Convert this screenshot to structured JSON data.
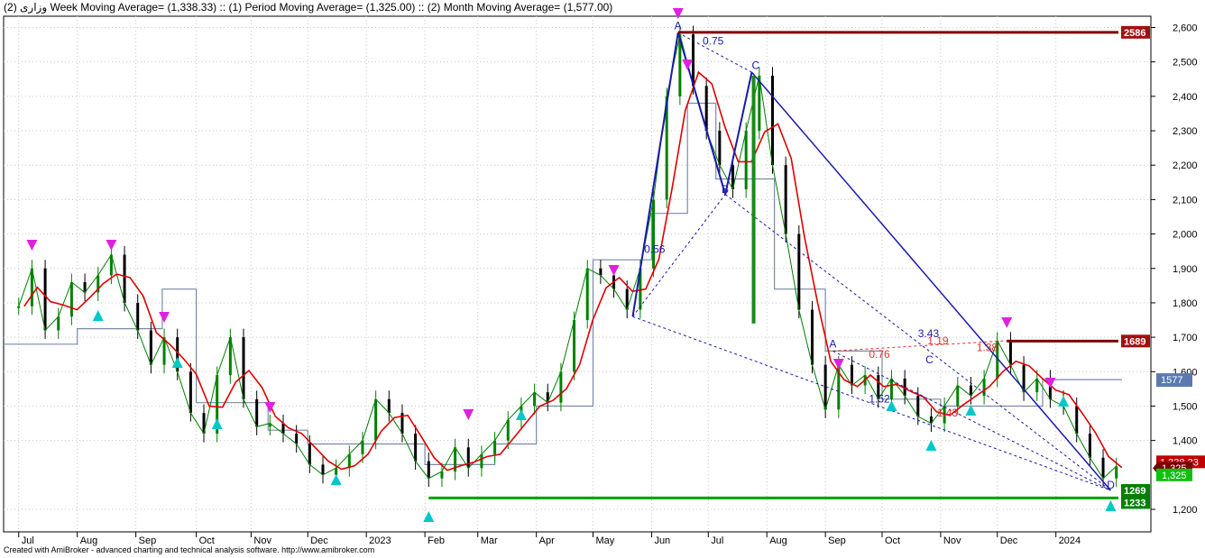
{
  "header": "وزارى (2) Week Moving Average= (1,338.33) :: (1) Period Moving Average= (1,325.00) :: (2) Month Moving Average= (1,577.00)",
  "footer": "Created with AmiBroker - advanced charting and technical analysis software. http://www.amibroker.com",
  "colors": {
    "price_up": "#008000",
    "price_down": "#000000",
    "fast_ma": "#e00000",
    "step_ma": "#7a8aa8",
    "pattern": "#1a1aaa",
    "sell_arrow": "#e020e0",
    "buy_arrow": "#00c8c8",
    "resistance": "#800000",
    "support": "#00a000",
    "ratio_red": "#e03030"
  },
  "chart_data": {
    "type": "line",
    "title": "",
    "ylim": [
      1160,
      2680
    ],
    "y_ticks": [
      "2,600",
      "2,500",
      "2,400",
      "2,300",
      "2,200",
      "2,100",
      "2,000",
      "1,900",
      "1,800",
      "1,700",
      "1,600",
      "1,500",
      "1,400",
      "1,200"
    ],
    "y_tick_values": [
      2600,
      2500,
      2400,
      2300,
      2200,
      2100,
      2000,
      1900,
      1800,
      1700,
      1600,
      1500,
      1400,
      1200
    ],
    "x_labels": [
      "Jul",
      "Aug",
      "Sep",
      "Oct",
      "Nov",
      "Dec",
      "2023",
      "Feb",
      "Mar",
      "Apr",
      "May",
      "Jun",
      "Jul",
      "Aug",
      "Sep",
      "Oct",
      "Nov",
      "Dec",
      "2024"
    ],
    "grid": true,
    "price_points": [
      [
        "2022-07-01",
        1790
      ],
      [
        "2022-07-08",
        1900
      ],
      [
        "2022-07-15",
        1720
      ],
      [
        "2022-07-22",
        1760
      ],
      [
        "2022-07-29",
        1860
      ],
      [
        "2022-08-05",
        1830
      ],
      [
        "2022-08-12",
        1880
      ],
      [
        "2022-08-19",
        1940
      ],
      [
        "2022-08-26",
        1800
      ],
      [
        "2022-09-02",
        1720
      ],
      [
        "2022-09-09",
        1620
      ],
      [
        "2022-09-16",
        1700
      ],
      [
        "2022-09-23",
        1600
      ],
      [
        "2022-09-30",
        1480
      ],
      [
        "2022-10-07",
        1420
      ],
      [
        "2022-10-14",
        1590
      ],
      [
        "2022-10-21",
        1700
      ],
      [
        "2022-10-28",
        1520
      ],
      [
        "2022-11-04",
        1440
      ],
      [
        "2022-11-11",
        1450
      ],
      [
        "2022-11-18",
        1420
      ],
      [
        "2022-11-25",
        1390
      ],
      [
        "2022-12-02",
        1330
      ],
      [
        "2022-12-09",
        1300
      ],
      [
        "2022-12-16",
        1320
      ],
      [
        "2022-12-23",
        1360
      ],
      [
        "2022-12-30",
        1400
      ],
      [
        "2023-01-06",
        1520
      ],
      [
        "2023-01-13",
        1480
      ],
      [
        "2023-01-20",
        1420
      ],
      [
        "2023-01-27",
        1340
      ],
      [
        "2023-02-03",
        1290
      ],
      [
        "2023-02-10",
        1310
      ],
      [
        "2023-02-17",
        1380
      ],
      [
        "2023-02-24",
        1320
      ],
      [
        "2023-03-03",
        1360
      ],
      [
        "2023-03-10",
        1400
      ],
      [
        "2023-03-17",
        1460
      ],
      [
        "2023-03-24",
        1500
      ],
      [
        "2023-03-31",
        1540
      ],
      [
        "2023-04-07",
        1510
      ],
      [
        "2023-04-14",
        1600
      ],
      [
        "2023-04-21",
        1750
      ],
      [
        "2023-04-28",
        1900
      ],
      [
        "2023-05-05",
        1880
      ],
      [
        "2023-05-12",
        1840
      ],
      [
        "2023-05-19",
        1780
      ],
      [
        "2023-05-26",
        1900
      ],
      [
        "2023-06-02",
        2100
      ],
      [
        "2023-06-09",
        2400
      ],
      [
        "2023-06-16",
        2580
      ],
      [
        "2023-06-23",
        2430
      ],
      [
        "2023-06-30",
        2300
      ],
      [
        "2023-07-07",
        2200
      ],
      [
        "2023-07-14",
        2130
      ],
      [
        "2023-07-21",
        2300
      ],
      [
        "2023-07-28",
        2460
      ],
      [
        "2023-08-04",
        2200
      ],
      [
        "2023-08-11",
        2000
      ],
      [
        "2023-08-18",
        1780
      ],
      [
        "2023-08-25",
        1620
      ],
      [
        "2023-09-01",
        1490
      ],
      [
        "2023-09-08",
        1620
      ],
      [
        "2023-09-15",
        1560
      ],
      [
        "2023-09-22",
        1590
      ],
      [
        "2023-09-29",
        1520
      ],
      [
        "2023-10-06",
        1580
      ],
      [
        "2023-10-13",
        1530
      ],
      [
        "2023-10-20",
        1470
      ],
      [
        "2023-10-27",
        1450
      ],
      [
        "2023-11-03",
        1500
      ],
      [
        "2023-11-10",
        1560
      ],
      [
        "2023-11-17",
        1530
      ],
      [
        "2023-11-24",
        1580
      ],
      [
        "2023-12-01",
        1690
      ],
      [
        "2023-12-08",
        1620
      ],
      [
        "2023-12-15",
        1540
      ],
      [
        "2023-12-22",
        1580
      ],
      [
        "2023-12-29",
        1520
      ],
      [
        "2024-01-05",
        1500
      ],
      [
        "2024-01-12",
        1420
      ],
      [
        "2024-01-19",
        1350
      ],
      [
        "2024-01-26",
        1290
      ],
      [
        "2024-02-02",
        1325
      ]
    ],
    "level_labels": [
      "2586",
      "1689",
      "1577",
      "1,338.33",
      "1,325",
      "1,325",
      "1269",
      "1233"
    ],
    "ratio_labels": [
      "0.75",
      "0.56",
      "3.43",
      "1.19",
      "1.38",
      "0.76",
      "1.52",
      "1.43"
    ],
    "pattern_point_labels": [
      "A",
      "C",
      "B",
      "A",
      "C",
      "D"
    ]
  }
}
